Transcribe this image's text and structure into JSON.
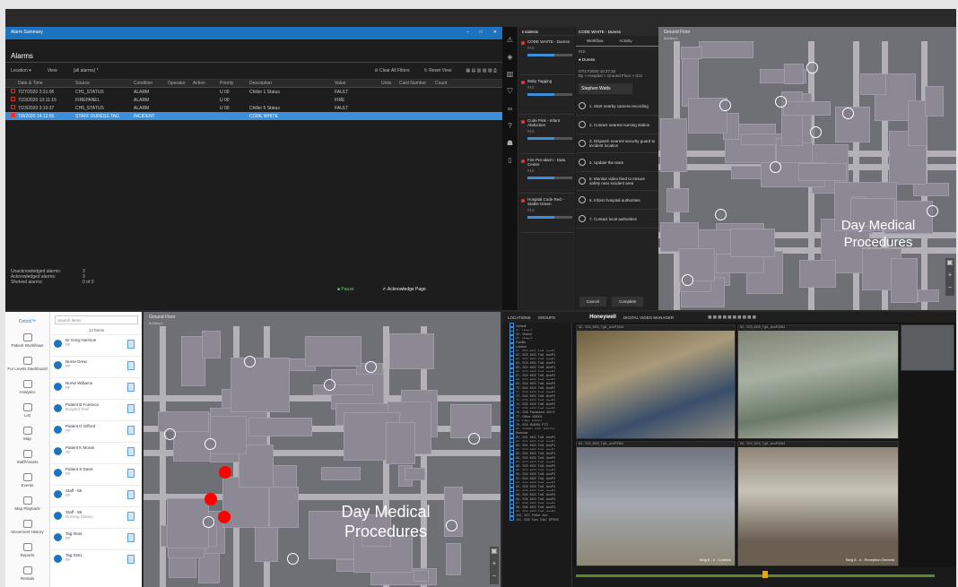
{
  "alarm_summary": {
    "window_title": "Alarm Summary",
    "title": "Alarms",
    "toolbar": {
      "location": "Location",
      "view_label": "View",
      "view_value": "(all alarms) *",
      "clear_filters": "Clear All Filters",
      "reset_view": "Reset View"
    },
    "columns": [
      "Date & Time",
      "Source",
      "Condition",
      "Operator",
      "Action",
      "Priority",
      "Description",
      "Value",
      "Units",
      "Card Number",
      "Count"
    ],
    "rows": [
      {
        "dt": "7/27/2020 2:31:06",
        "src": "CH1_STATUS",
        "cond": "ALARM",
        "pri": "U 00",
        "desc": "Chiller 1 Status",
        "val": "FAULT",
        "sel": false
      },
      {
        "dt": "7/23/2020 13:11:16",
        "src": "FIREPANEL",
        "cond": "ALARM",
        "pri": "U 00",
        "desc": "",
        "val": "FIRE",
        "sel": false
      },
      {
        "dt": "7/23/2020 3:10:37",
        "src": "CH5_STATUS",
        "cond": "ALARM",
        "pri": "U 00",
        "desc": "Chiller 5 Status",
        "val": "FAULT",
        "sel": false
      },
      {
        "dt": "7/8/2020 14:12:55",
        "src": "STAFF DURESS TAG",
        "cond": "INCIDENT",
        "pri": "",
        "desc": "CODE WHITE",
        "val": "",
        "sel": true
      }
    ],
    "footer": {
      "unack_label": "Unacknowledged alarms:",
      "unack_val": "3",
      "ack_label": "Acknowledged alarms:",
      "ack_val": "3",
      "shelved_label": "Shelved alarms:",
      "shelved_val": "0",
      "shelved_of": "of",
      "shelved_total": "0"
    },
    "buttons": {
      "pause": "Pause",
      "ack_page": "Acknowledge Page"
    }
  },
  "incidents": {
    "header": "Incidents",
    "detail_title": "CODE WHITE - Duress",
    "tabs": [
      "Workflow",
      "Activity"
    ],
    "items": [
      {
        "title": "CODE WHITE - Duress",
        "sub": "#10"
      },
      {
        "title": "Baby Tagging",
        "sub": "#10"
      },
      {
        "title": "Code Pink - Infant Abduction",
        "sub": "#10"
      },
      {
        "title": "Fire Pre-alarm - Data Center",
        "sub": "#10"
      },
      {
        "title": "Hospital Code Red - Stable Green",
        "sub": "#10"
      }
    ],
    "detail_id": "#10",
    "detail_type": "Duress",
    "detail_date": "07/17/2020 10:27:32",
    "location": "By > Hospital > Ground Floor > ICU",
    "assignee": "Stephen Watts",
    "steps": [
      "1. Start nearby camera recording",
      "2. Contact nearest nursing station",
      "3. Dispatch nearest security guard to incident location",
      "4. Update the team",
      "5. Monitor video feed to ensure safety near incident area",
      "6. Inform hospital authorities",
      "7. Contact local authorities"
    ],
    "cancel": "Cancel",
    "complete": "Complete"
  },
  "map_top": {
    "title": "Ground Floor",
    "building": "Building A",
    "label1": "Day Medical",
    "label2": "Procedures"
  },
  "map_bottom": {
    "title": "Ground Floor",
    "building": "Building A",
    "label1": "Day Medical",
    "label2": "Procedures"
  },
  "mobile": {
    "brand": "Cntxxt™",
    "nav": [
      "Patient Workflows",
      "Fur Levels Dashboard",
      "Analytics",
      "List",
      "Map",
      "Staff/Assets",
      "Events",
      "Map Playback",
      "Movement History",
      "Reports",
      "Rentals"
    ],
    "search_placeholder": "Search Items",
    "count": "13 Items",
    "items": [
      {
        "name": "Dr Greg Harrison",
        "s": "RF"
      },
      {
        "name": "Nurse Drew",
        "s": "RF"
      },
      {
        "name": "Nurse Williams",
        "s": "RF"
      },
      {
        "name": "Patient B Fonseca",
        "s": "Burgard Wall"
      },
      {
        "name": "Patient D Gifford",
        "s": "RF"
      },
      {
        "name": "Patient K Moran",
        "s": "RF"
      },
      {
        "name": "Patient S Davis",
        "s": "RF"
      },
      {
        "name": "Staff - 56",
        "s": "RF"
      },
      {
        "name": "Staff - 86",
        "s": "Nursing Station"
      },
      {
        "name": "Tag 0044",
        "s": "RF"
      },
      {
        "name": "Tag 0261",
        "s": "RF"
      }
    ]
  },
  "video": {
    "tabs": [
      "LOCATIONS",
      "GROUPS"
    ],
    "brand": "Honeywell",
    "product": "DIGITAL VIDEO MANAGER",
    "cams": [
      "62 - S03_M03_Tgt1_AxsP1344",
      "63 - S03_M03_Tgt1_AxsP3364",
      "64 - S03_M03_Tgt1_AxsP3364",
      "65 - S03_M03_Tgt1_AxsP3364"
    ],
    "overlay1": "Bldg 8 - 4 - Corridor",
    "overlay2": "Bldg 8 - 4 - Reception General",
    "tree": [
      "Default",
      "01 - Video1",
      "02 - Video2",
      "03 - Video3",
      "Facility",
      "London",
      "61 - S03_M03_Tgt1_AxsP1",
      "62 - S03_M03_Tgt1_AxsP1",
      "63 - S03_M03_Tgt1_AxsP1",
      "64 - S03_M03_Tgt1_AxsP1",
      "65 - S03_M03_Tgt1_AxsP1",
      "66 - S03_M03_Tgt1_AxsP2",
      "67 - S03_M03_Tgt1_AxsP2",
      "68 - S04_M03_Tgt1_AxsP2",
      "69 - S04_M03_Tgt1_AxsP2",
      "70 - S04_M03_Tgt1_AxsP2",
      "71 - S04_M03_Tgt1_AxsP2",
      "72 - S04_M03_Tgt1_AxsP2",
      "73 - S05_M03_Tgt1_AxsP2",
      "74 - S05_M03_Tgt1_AxsP2",
      "75 - S05_M03_Tgt1_AxsP3",
      "76 - S06_Panasonic_WV-S",
      "77 - Office_M5004",
      "78 - Clinic_M5004",
      "79 - S05_ID4055_PTZ",
      "80 - S05HD_0401_E6022+",
      "Moscow",
      "81 - S01_M03_Tgt1_AxsP1",
      "82 - S01_M03_Tgt1_AxsP1",
      "83 - S01_M03_Tgt1_AxsP1",
      "84 - S02_M03_Tgt1_AxsP1",
      "85 - S02_M03_Tgt1_AxsP1",
      "86 - S02_M03_Tgt1_AxsP2",
      "87 - S03_M03_Tgt1_AxsP2",
      "88 - S03_M03_Tgt1_AxsP2",
      "89 - S03_M03_Tgt1_AxsP2",
      "90 - S04_M03_Tgt1_AxsP3",
      "91 - S04_M03_Tgt1_AxsP3",
      "92 - S04_M03_Tgt1_AxsP3",
      "93 - S05_M03_Tgt1_AxsP3",
      "94 - S05_M03_Tgt1_AxsP3",
      "95 - S05_M03_Tgt1_AxsP3",
      "96 - S06_M03_Tgt1_AxsP3",
      "97 - S06_M03_Tgt1_AxsP4",
      "98 - S06_M03_Tgt1_AxsP4",
      "99 - S06_M03_Tgt1_AxsP4",
      "100 - S07_Police_Acc",
      "101 - S08_Tyco_DAC_EP5S0"
    ]
  }
}
